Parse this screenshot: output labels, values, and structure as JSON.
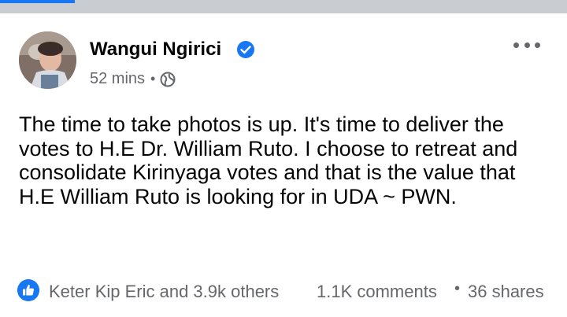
{
  "post": {
    "author": "Wangui Ngirici",
    "time": "52 mins",
    "text": "The time to take photos is up. It's time to deliver the votes to H.E Dr. William Ruto. I choose to retreat and consolidate Kirinyaga votes and that is the value that H.E William Ruto is looking for in UDA ~ PWN.",
    "verified_icon": "verified-badge",
    "audience_icon": "globe-icon"
  },
  "footer": {
    "reactions": "Keter Kip Eric and 3.9k others",
    "comments": "1.1K comments",
    "separator": "•",
    "shares": "36 shares",
    "reaction_icon": "like-icon"
  },
  "colors": {
    "accent": "#1877f2",
    "text_primary": "#050505",
    "text_secondary": "#65676b",
    "divider": "#c9ccd1"
  }
}
